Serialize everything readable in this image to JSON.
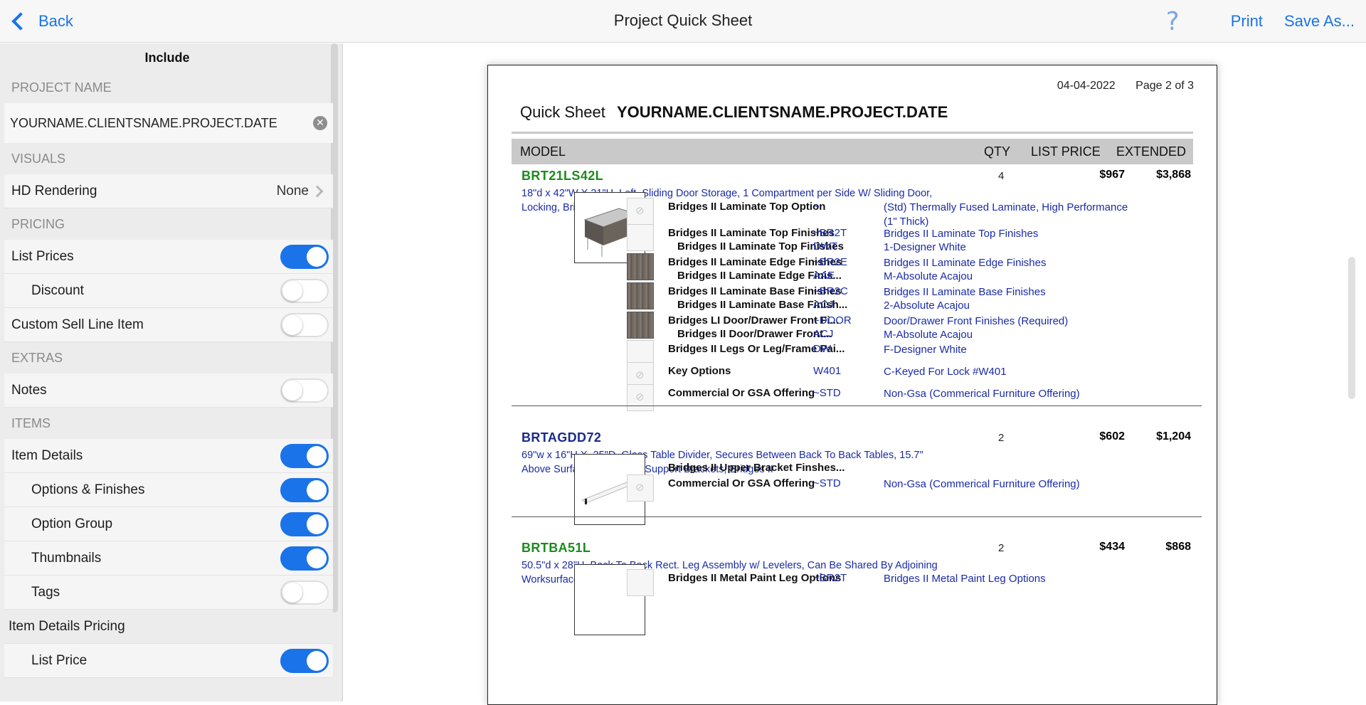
{
  "topbar": {
    "back_label": "Back",
    "title": "Project Quick Sheet",
    "help_icon": "?",
    "print_label": "Print",
    "save_as_label": "Save As..."
  },
  "sidebar": {
    "title": "Include",
    "project_name_header": "PROJECT NAME",
    "project_name_value": "YOURNAME.CLIENTSNAME.PROJECT.DATE",
    "visuals_header": "VISUALS",
    "hd_rendering_label": "HD Rendering",
    "hd_rendering_value": "None",
    "pricing_header": "PRICING",
    "list_prices_label": "List Prices",
    "list_prices_on": true,
    "discount_label": "Discount",
    "discount_on": false,
    "custom_sell_label": "Custom Sell Line Item",
    "custom_sell_on": false,
    "extras_header": "EXTRAS",
    "notes_label": "Notes",
    "notes_on": false,
    "items_header": "ITEMS",
    "item_details_label": "Item Details",
    "item_details_on": true,
    "options_finishes_label": "Options & Finishes",
    "options_finishes_on": true,
    "option_group_label": "Option Group",
    "option_group_on": true,
    "thumbnails_label": "Thumbnails",
    "thumbnails_on": true,
    "tags_label": "Tags",
    "tags_on": false,
    "item_details_pricing_label": "Item Details Pricing",
    "list_price_label": "List Price",
    "list_price_on": true
  },
  "document": {
    "date": "04-04-2022",
    "page": "Page 2 of 3",
    "sheet_label": "Quick Sheet",
    "project_name": "YOURNAME.CLIENTSNAME.PROJECT.DATE",
    "headers": {
      "model": "MODEL",
      "qty": "QTY",
      "list_price": "LIST PRICE",
      "extended": "EXTENDED"
    },
    "items": [
      {
        "model": "BRT21LS42L",
        "model_color": "#1e8a1e",
        "qty": "4",
        "list_price": "$967",
        "extended": "$3,868",
        "desc": "18\"d x 42\"W X 21\"H, Left, Sliding Door Storage, 1 Compartment per Side W/ Sliding Door, Locking, Bridges II",
        "options": [
          {
            "name": "Bridges II Laminate Top Option",
            "code": "~",
            "desc": "(Std) Thermally Fused Laminate, High Performance (1\" Thick)"
          },
          {
            "name": "Bridges II Laminate Top Finishes",
            "code": "~BR2T",
            "desc": "Bridges II Laminate Top Finishes"
          },
          {
            "name": "Bridges II Laminate Top Finishes",
            "code": "DWT",
            "desc": "1-Designer White"
          },
          {
            "name": "Bridges II Laminate Edge Finishes",
            "code": "~BR2E",
            "desc": "Bridges II Laminate Edge Finishes"
          },
          {
            "name": "Bridges II Laminate Edge Finis...",
            "code": "AAE",
            "desc": "M-Absolute Acajou"
          },
          {
            "name": "Bridges II Laminate Base Finishes",
            "code": "~BR2C",
            "desc": "Bridges II Laminate Base Finishes"
          },
          {
            "name": "Bridges II Laminate Base Finish...",
            "code": "ACJ",
            "desc": "2-Absolute Acajou"
          },
          {
            "name": "Bridges LI Door/Drawer Front Fi...",
            "code": "~DOOR",
            "desc": "Door/Drawer Front Finishes (Required)"
          },
          {
            "name": "Bridges II Door/Drawer  Front...",
            "code": "ACJ",
            "desc": "M-Absolute Acajou"
          },
          {
            "name": "Bridges II Legs Or Leg/Frame Pai...",
            "code": "DW",
            "desc": "F-Designer White"
          },
          {
            "name": "Key Options",
            "code": "W401",
            "desc": "C-Keyed For Lock #W401"
          },
          {
            "name": "Commercial Or GSA Offering",
            "code": "~STD",
            "desc": "Non-Gsa (Commerical Furniture Offering)"
          }
        ]
      },
      {
        "model": "BRTAGDD72",
        "model_color": "#1a2b8a",
        "qty": "2",
        "list_price": "$602",
        "extended": "$1,204",
        "desc": "69\"w x 16\"H X .25\"D, Glass Table Divider, Secures Between Back To Back Tables, 15.7\" Above Surface, Includes 2 Support Brackets, Bridges II",
        "options": [
          {
            "name": "Bridges II Upper Bracket Finshes...",
            "code": "",
            "desc": ""
          },
          {
            "name": "Commercial Or GSA Offering",
            "code": "~STD",
            "desc": "Non-Gsa (Commerical Furniture Offering)"
          }
        ]
      },
      {
        "model": "BRTBA51L",
        "model_color": "#1e8a1e",
        "qty": "2",
        "list_price": "$434",
        "extended": "$868",
        "desc": "50.5\"d x 28\"H, Back To Back Rect. Leg Assembly w/ Levelers, Can Be Shared By Adjoining Worksurfaces, Bridges II",
        "options": [
          {
            "name": "Bridges II Metal Paint Leg Options",
            "code": "~BR2T",
            "desc": "Bridges II Metal Paint Leg Options"
          }
        ]
      }
    ]
  },
  "colors": {
    "accent": "#1a73e8",
    "link_text": "#1a2ba8",
    "model_green": "#1e8a1e",
    "model_navy": "#1a2b8a"
  },
  "icons": {
    "back": "chevron-left-icon",
    "help": "question-mark-icon",
    "clear": "clear-circle-icon",
    "disclosure": "chevron-right-icon",
    "no_image": "no-image-icon"
  }
}
